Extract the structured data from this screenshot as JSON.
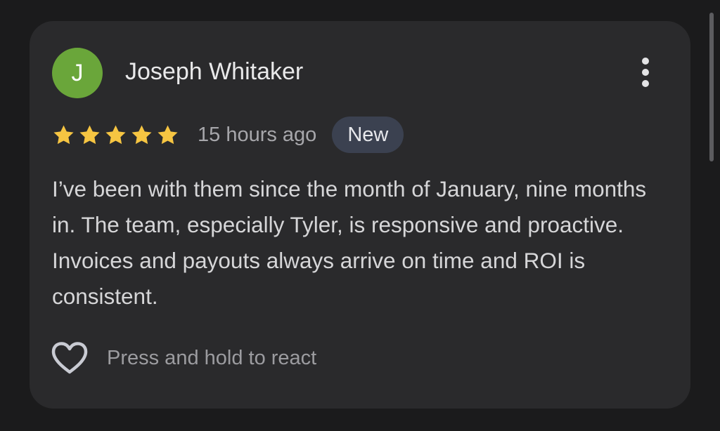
{
  "review": {
    "author_name": "Joseph Whitaker",
    "avatar_initial": "J",
    "avatar_color": "#6aa63a",
    "more_menu_icon": "vertical-dots-icon",
    "rating": 5,
    "rating_max": 5,
    "star_color": "#f6c542",
    "time_ago": "15 hours ago",
    "badge_label": "New",
    "text": "I’ve been with them since the month of January, nine months in. The team, especially Tyler, is responsive and proactive. Invoices and payouts always arrive on time and ROI is consistent.",
    "react_icon": "heart-outline-icon",
    "react_label": "Press and hold to react"
  }
}
